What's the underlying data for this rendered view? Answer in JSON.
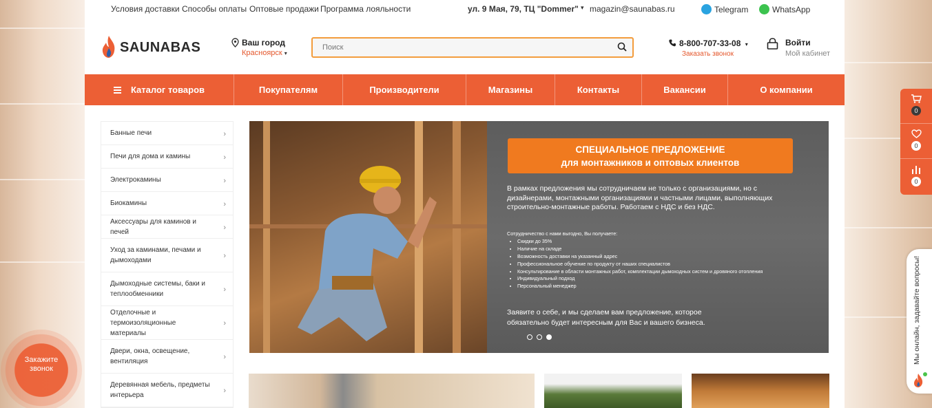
{
  "topbar": {
    "links": [
      "Условия доставки",
      "Способы оплаты",
      "Оптовые продажи",
      "Программа лояльности"
    ],
    "address": "ул. 9 Мая, 79, ТЦ \"Dommer\"",
    "email": "magazin@saunabas.ru",
    "telegram": "Telegram",
    "whatsapp": "WhatsApp"
  },
  "header": {
    "logo_text": "SAUNABAS",
    "city_label": "Ваш город",
    "city_value": "Красноярск",
    "search_placeholder": "Поиск",
    "phone": "8-800-707-33-08",
    "callback": "Заказать звонок",
    "login": "Войти",
    "cabinet": "Мой кабинет"
  },
  "nav": {
    "items": [
      "Каталог товаров",
      "Покупателям",
      "Производители",
      "Магазины",
      "Контакты",
      "Вакансии",
      "О компании"
    ]
  },
  "sidebar": {
    "items": [
      "Банные печи",
      "Печи для дома и камины",
      "Электрокамины",
      "Биокамины",
      "Аксессуары для каминов и печей",
      "Уход за каминами, печами и дымоходами",
      "Дымоходные системы, баки и теплообменники",
      "Отделочные и термоизоляционные материалы",
      "Двери, окна, освещение, вентиляция",
      "Деревянная мебель, предметы интерьера"
    ]
  },
  "banner": {
    "title_line1": "СПЕЦИАЛЬНОЕ ПРЕДЛОЖЕНИЕ",
    "title_line2": "для монтажников и оптовых клиентов",
    "paragraph": "В рамках предложения мы сотрудничаем не только с организациями, но с дизайнерами, монтажными организациями и частными лицами, выполняющих строительно-монтажные работы. Работаем с НДС и без НДС.",
    "benefits_intro": "Сотрудничество с нами выгодно, Вы получаете:",
    "benefits": [
      "Скидки до 35%",
      "Наличие на складе",
      "Возможность доставки на указанный адрес",
      "Профессиональное обучение по продукту от наших специалистов",
      "Консультирование в области монтажных работ, комплектации дымоходных систем и дровяного отопления",
      "Индивидуальный подход",
      "Персональный менеджер"
    ],
    "cta": "Заявите о себе, и мы сделаем вам предложение, которое обязательно будет интересным для Вас и вашего бизнеса.",
    "slides_total": 3,
    "slide_active": 3
  },
  "rightbar": {
    "cart_count": "0",
    "favorites_count": "0",
    "compare_count": "0"
  },
  "chat": {
    "label": "Мы онлайн, задавайте вопросы!"
  },
  "callme": {
    "label_line1": "Закажите",
    "label_line2": "звонок"
  },
  "colors": {
    "accent": "#ec5f35",
    "offer_orange": "#f07a1f",
    "search_border": "#f39c3c"
  }
}
